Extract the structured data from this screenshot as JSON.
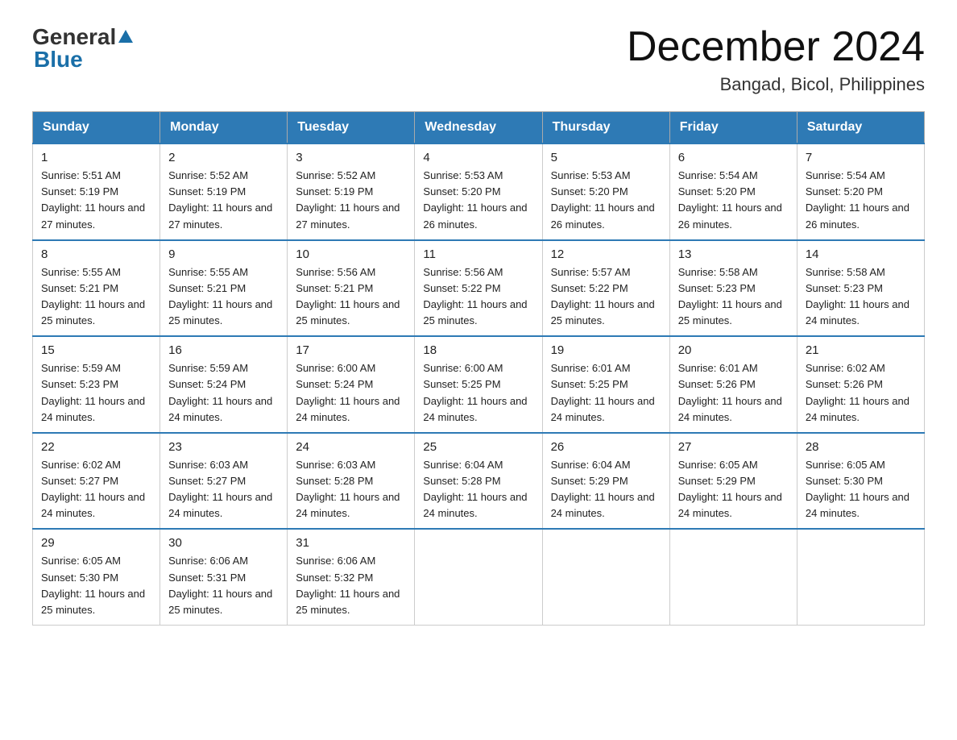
{
  "logo": {
    "general": "General",
    "blue": "Blue"
  },
  "header": {
    "month_title": "December 2024",
    "location": "Bangad, Bicol, Philippines"
  },
  "days_of_week": [
    "Sunday",
    "Monday",
    "Tuesday",
    "Wednesday",
    "Thursday",
    "Friday",
    "Saturday"
  ],
  "weeks": [
    [
      {
        "day": "1",
        "sunrise": "5:51 AM",
        "sunset": "5:19 PM",
        "daylight": "11 hours and 27 minutes."
      },
      {
        "day": "2",
        "sunrise": "5:52 AM",
        "sunset": "5:19 PM",
        "daylight": "11 hours and 27 minutes."
      },
      {
        "day": "3",
        "sunrise": "5:52 AM",
        "sunset": "5:19 PM",
        "daylight": "11 hours and 27 minutes."
      },
      {
        "day": "4",
        "sunrise": "5:53 AM",
        "sunset": "5:20 PM",
        "daylight": "11 hours and 26 minutes."
      },
      {
        "day": "5",
        "sunrise": "5:53 AM",
        "sunset": "5:20 PM",
        "daylight": "11 hours and 26 minutes."
      },
      {
        "day": "6",
        "sunrise": "5:54 AM",
        "sunset": "5:20 PM",
        "daylight": "11 hours and 26 minutes."
      },
      {
        "day": "7",
        "sunrise": "5:54 AM",
        "sunset": "5:20 PM",
        "daylight": "11 hours and 26 minutes."
      }
    ],
    [
      {
        "day": "8",
        "sunrise": "5:55 AM",
        "sunset": "5:21 PM",
        "daylight": "11 hours and 25 minutes."
      },
      {
        "day": "9",
        "sunrise": "5:55 AM",
        "sunset": "5:21 PM",
        "daylight": "11 hours and 25 minutes."
      },
      {
        "day": "10",
        "sunrise": "5:56 AM",
        "sunset": "5:21 PM",
        "daylight": "11 hours and 25 minutes."
      },
      {
        "day": "11",
        "sunrise": "5:56 AM",
        "sunset": "5:22 PM",
        "daylight": "11 hours and 25 minutes."
      },
      {
        "day": "12",
        "sunrise": "5:57 AM",
        "sunset": "5:22 PM",
        "daylight": "11 hours and 25 minutes."
      },
      {
        "day": "13",
        "sunrise": "5:58 AM",
        "sunset": "5:23 PM",
        "daylight": "11 hours and 25 minutes."
      },
      {
        "day": "14",
        "sunrise": "5:58 AM",
        "sunset": "5:23 PM",
        "daylight": "11 hours and 24 minutes."
      }
    ],
    [
      {
        "day": "15",
        "sunrise": "5:59 AM",
        "sunset": "5:23 PM",
        "daylight": "11 hours and 24 minutes."
      },
      {
        "day": "16",
        "sunrise": "5:59 AM",
        "sunset": "5:24 PM",
        "daylight": "11 hours and 24 minutes."
      },
      {
        "day": "17",
        "sunrise": "6:00 AM",
        "sunset": "5:24 PM",
        "daylight": "11 hours and 24 minutes."
      },
      {
        "day": "18",
        "sunrise": "6:00 AM",
        "sunset": "5:25 PM",
        "daylight": "11 hours and 24 minutes."
      },
      {
        "day": "19",
        "sunrise": "6:01 AM",
        "sunset": "5:25 PM",
        "daylight": "11 hours and 24 minutes."
      },
      {
        "day": "20",
        "sunrise": "6:01 AM",
        "sunset": "5:26 PM",
        "daylight": "11 hours and 24 minutes."
      },
      {
        "day": "21",
        "sunrise": "6:02 AM",
        "sunset": "5:26 PM",
        "daylight": "11 hours and 24 minutes."
      }
    ],
    [
      {
        "day": "22",
        "sunrise": "6:02 AM",
        "sunset": "5:27 PM",
        "daylight": "11 hours and 24 minutes."
      },
      {
        "day": "23",
        "sunrise": "6:03 AM",
        "sunset": "5:27 PM",
        "daylight": "11 hours and 24 minutes."
      },
      {
        "day": "24",
        "sunrise": "6:03 AM",
        "sunset": "5:28 PM",
        "daylight": "11 hours and 24 minutes."
      },
      {
        "day": "25",
        "sunrise": "6:04 AM",
        "sunset": "5:28 PM",
        "daylight": "11 hours and 24 minutes."
      },
      {
        "day": "26",
        "sunrise": "6:04 AM",
        "sunset": "5:29 PM",
        "daylight": "11 hours and 24 minutes."
      },
      {
        "day": "27",
        "sunrise": "6:05 AM",
        "sunset": "5:29 PM",
        "daylight": "11 hours and 24 minutes."
      },
      {
        "day": "28",
        "sunrise": "6:05 AM",
        "sunset": "5:30 PM",
        "daylight": "11 hours and 24 minutes."
      }
    ],
    [
      {
        "day": "29",
        "sunrise": "6:05 AM",
        "sunset": "5:30 PM",
        "daylight": "11 hours and 25 minutes."
      },
      {
        "day": "30",
        "sunrise": "6:06 AM",
        "sunset": "5:31 PM",
        "daylight": "11 hours and 25 minutes."
      },
      {
        "day": "31",
        "sunrise": "6:06 AM",
        "sunset": "5:32 PM",
        "daylight": "11 hours and 25 minutes."
      },
      null,
      null,
      null,
      null
    ]
  ],
  "labels": {
    "sunrise": "Sunrise:",
    "sunset": "Sunset:",
    "daylight": "Daylight:"
  }
}
